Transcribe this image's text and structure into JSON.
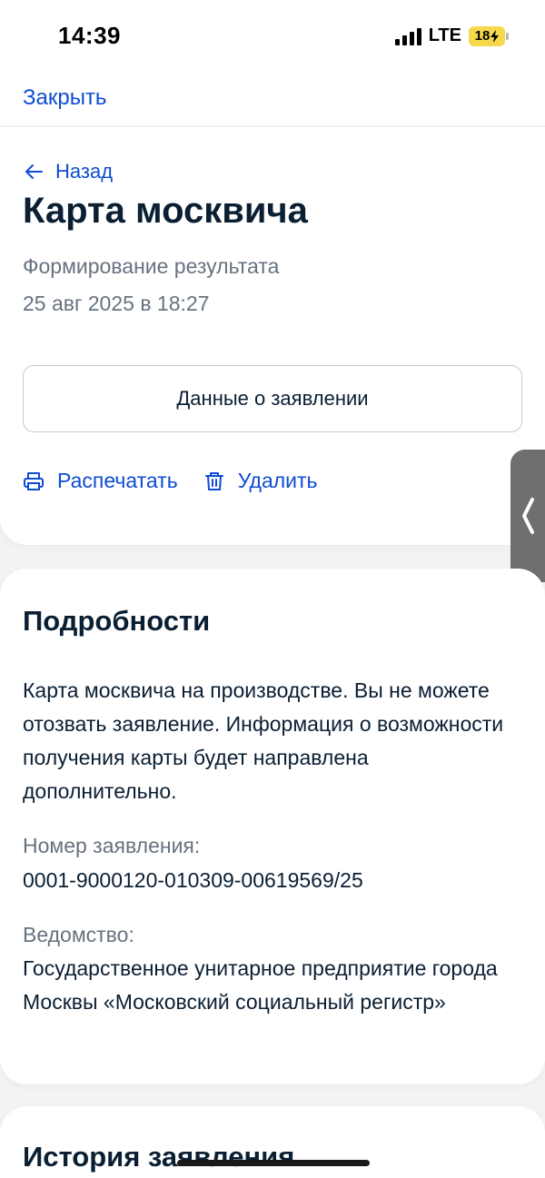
{
  "status_bar": {
    "time": "14:39",
    "network": "LTE",
    "battery": "18"
  },
  "header": {
    "close_label": "Закрыть"
  },
  "main_card": {
    "back_label": "Назад",
    "title": "Карта москвича",
    "status": "Формирование результата",
    "date": "25 авг 2025 в 18:27",
    "details_button_label": "Данные о заявлении",
    "actions": {
      "print_label": "Распечатать",
      "delete_label": "Удалить"
    }
  },
  "details": {
    "title": "Подробности",
    "description": "Карта москвича на производстве. Вы не можете отозвать заявление. Информация о возможности получения карты будет направлена дополнительно.",
    "application_number_label": "Номер заявления:",
    "application_number": "0001-9000120-010309-00619569/25",
    "department_label": "Ведомство:",
    "department": "Государственное унитарное предприятие города Москвы «Московский социальный регистр»"
  },
  "history": {
    "title": "История заявления"
  },
  "colors": {
    "accent": "#0d4cd3",
    "text_primary": "#0b1f33",
    "text_secondary": "#66727f",
    "background": "#f2f3f5"
  }
}
